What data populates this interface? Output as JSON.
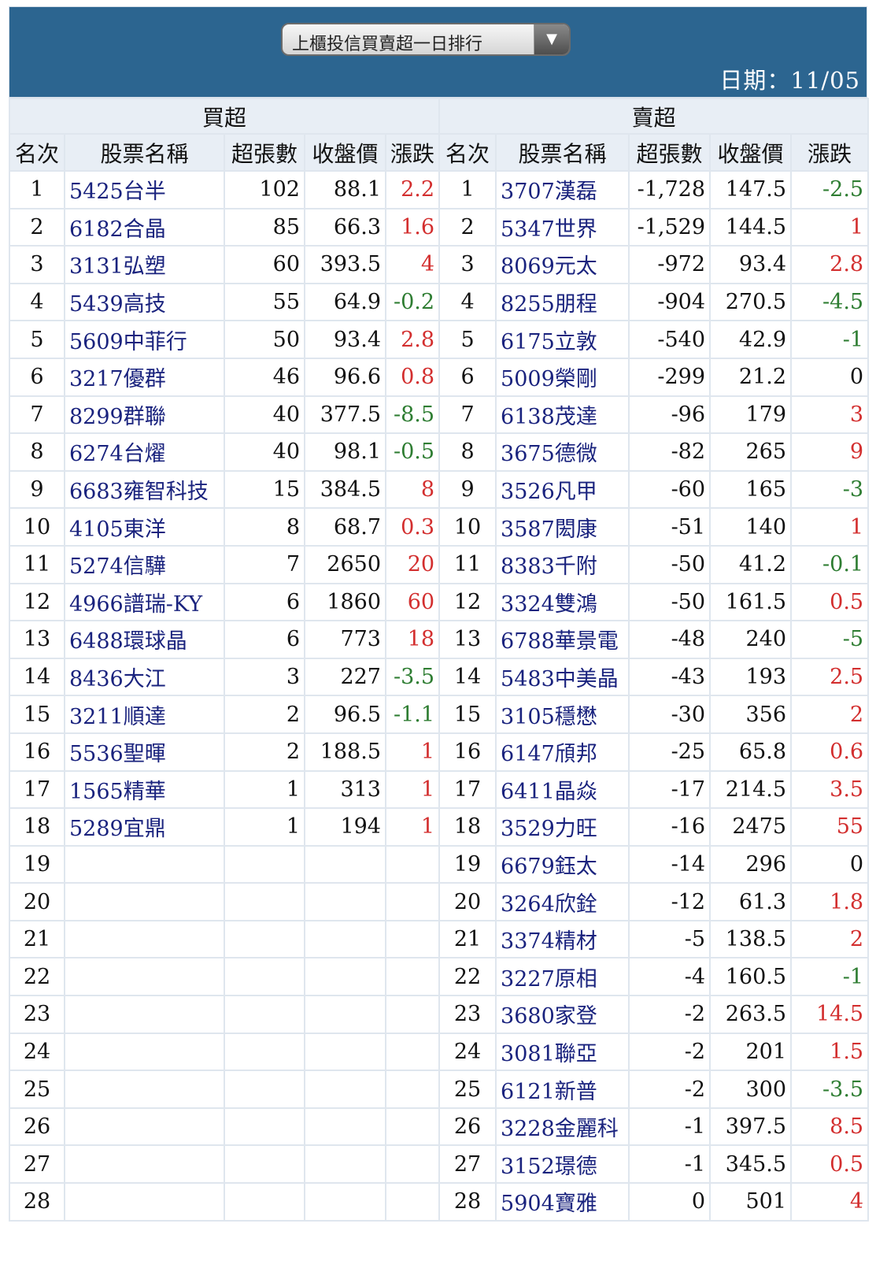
{
  "select": {
    "label": "上櫃投信買賣超一日排行",
    "arrow": "▼"
  },
  "date_text": "日期：11/05",
  "headers": {
    "buy_section": "買超",
    "sell_section": "賣超",
    "rank": "名次",
    "stock": "股票名稱",
    "volume": "超張數",
    "close": "收盤價",
    "change": "漲跌"
  },
  "colors": {
    "header_bg": "#2c6590",
    "up": "#d32f2f",
    "down": "#2e7d32",
    "link": "#1a237e"
  },
  "rows": [
    {
      "rank": "1",
      "buy": {
        "name": "5425台半",
        "vol": "102",
        "price": "88.1",
        "chg": "2.2"
      },
      "sell": {
        "name": "3707漢磊",
        "vol": "-1,728",
        "price": "147.5",
        "chg": "-2.5"
      }
    },
    {
      "rank": "2",
      "buy": {
        "name": "6182合晶",
        "vol": "85",
        "price": "66.3",
        "chg": "1.6"
      },
      "sell": {
        "name": "5347世界",
        "vol": "-1,529",
        "price": "144.5",
        "chg": "1"
      }
    },
    {
      "rank": "3",
      "buy": {
        "name": "3131弘塑",
        "vol": "60",
        "price": "393.5",
        "chg": "4"
      },
      "sell": {
        "name": "8069元太",
        "vol": "-972",
        "price": "93.4",
        "chg": "2.8"
      }
    },
    {
      "rank": "4",
      "buy": {
        "name": "5439高技",
        "vol": "55",
        "price": "64.9",
        "chg": "-0.2"
      },
      "sell": {
        "name": "8255朋程",
        "vol": "-904",
        "price": "270.5",
        "chg": "-4.5"
      }
    },
    {
      "rank": "5",
      "buy": {
        "name": "5609中菲行",
        "vol": "50",
        "price": "93.4",
        "chg": "2.8"
      },
      "sell": {
        "name": "6175立敦",
        "vol": "-540",
        "price": "42.9",
        "chg": "-1"
      }
    },
    {
      "rank": "6",
      "buy": {
        "name": "3217優群",
        "vol": "46",
        "price": "96.6",
        "chg": "0.8"
      },
      "sell": {
        "name": "5009榮剛",
        "vol": "-299",
        "price": "21.2",
        "chg": "0"
      }
    },
    {
      "rank": "7",
      "buy": {
        "name": "8299群聯",
        "vol": "40",
        "price": "377.5",
        "chg": "-8.5"
      },
      "sell": {
        "name": "6138茂達",
        "vol": "-96",
        "price": "179",
        "chg": "3"
      }
    },
    {
      "rank": "8",
      "buy": {
        "name": "6274台燿",
        "vol": "40",
        "price": "98.1",
        "chg": "-0.5"
      },
      "sell": {
        "name": "3675德微",
        "vol": "-82",
        "price": "265",
        "chg": "9"
      }
    },
    {
      "rank": "9",
      "buy": {
        "name": "6683雍智科技",
        "vol": "15",
        "price": "384.5",
        "chg": "8"
      },
      "sell": {
        "name": "3526凡甲",
        "vol": "-60",
        "price": "165",
        "chg": "-3"
      }
    },
    {
      "rank": "10",
      "buy": {
        "name": "4105東洋",
        "vol": "8",
        "price": "68.7",
        "chg": "0.3"
      },
      "sell": {
        "name": "3587閎康",
        "vol": "-51",
        "price": "140",
        "chg": "1"
      }
    },
    {
      "rank": "11",
      "buy": {
        "name": "5274信驊",
        "vol": "7",
        "price": "2650",
        "chg": "20"
      },
      "sell": {
        "name": "8383千附",
        "vol": "-50",
        "price": "41.2",
        "chg": "-0.1"
      }
    },
    {
      "rank": "12",
      "buy": {
        "name": "4966譜瑞-KY",
        "vol": "6",
        "price": "1860",
        "chg": "60"
      },
      "sell": {
        "name": "3324雙鴻",
        "vol": "-50",
        "price": "161.5",
        "chg": "0.5"
      }
    },
    {
      "rank": "13",
      "buy": {
        "name": "6488環球晶",
        "vol": "6",
        "price": "773",
        "chg": "18"
      },
      "sell": {
        "name": "6788華景電",
        "vol": "-48",
        "price": "240",
        "chg": "-5"
      }
    },
    {
      "rank": "14",
      "buy": {
        "name": "8436大江",
        "vol": "3",
        "price": "227",
        "chg": "-3.5"
      },
      "sell": {
        "name": "5483中美晶",
        "vol": "-43",
        "price": "193",
        "chg": "2.5"
      }
    },
    {
      "rank": "15",
      "buy": {
        "name": "3211順達",
        "vol": "2",
        "price": "96.5",
        "chg": "-1.1"
      },
      "sell": {
        "name": "3105穩懋",
        "vol": "-30",
        "price": "356",
        "chg": "2"
      }
    },
    {
      "rank": "16",
      "buy": {
        "name": "5536聖暉",
        "vol": "2",
        "price": "188.5",
        "chg": "1"
      },
      "sell": {
        "name": "6147頎邦",
        "vol": "-25",
        "price": "65.8",
        "chg": "0.6"
      }
    },
    {
      "rank": "17",
      "buy": {
        "name": "1565精華",
        "vol": "1",
        "price": "313",
        "chg": "1"
      },
      "sell": {
        "name": "6411晶焱",
        "vol": "-17",
        "price": "214.5",
        "chg": "3.5"
      }
    },
    {
      "rank": "18",
      "buy": {
        "name": "5289宜鼎",
        "vol": "1",
        "price": "194",
        "chg": "1"
      },
      "sell": {
        "name": "3529力旺",
        "vol": "-16",
        "price": "2475",
        "chg": "55"
      }
    },
    {
      "rank": "19",
      "buy": null,
      "sell": {
        "name": "6679鈺太",
        "vol": "-14",
        "price": "296",
        "chg": "0"
      }
    },
    {
      "rank": "20",
      "buy": null,
      "sell": {
        "name": "3264欣銓",
        "vol": "-12",
        "price": "61.3",
        "chg": "1.8"
      }
    },
    {
      "rank": "21",
      "buy": null,
      "sell": {
        "name": "3374精材",
        "vol": "-5",
        "price": "138.5",
        "chg": "2"
      }
    },
    {
      "rank": "22",
      "buy": null,
      "sell": {
        "name": "3227原相",
        "vol": "-4",
        "price": "160.5",
        "chg": "-1"
      }
    },
    {
      "rank": "23",
      "buy": null,
      "sell": {
        "name": "3680家登",
        "vol": "-2",
        "price": "263.5",
        "chg": "14.5"
      }
    },
    {
      "rank": "24",
      "buy": null,
      "sell": {
        "name": "3081聯亞",
        "vol": "-2",
        "price": "201",
        "chg": "1.5"
      }
    },
    {
      "rank": "25",
      "buy": null,
      "sell": {
        "name": "6121新普",
        "vol": "-2",
        "price": "300",
        "chg": "-3.5"
      }
    },
    {
      "rank": "26",
      "buy": null,
      "sell": {
        "name": "3228金麗科",
        "vol": "-1",
        "price": "397.5",
        "chg": "8.5"
      }
    },
    {
      "rank": "27",
      "buy": null,
      "sell": {
        "name": "3152璟德",
        "vol": "-1",
        "price": "345.5",
        "chg": "0.5"
      }
    },
    {
      "rank": "28",
      "buy": null,
      "sell": {
        "name": "5904寶雅",
        "vol": "0",
        "price": "501",
        "chg": "4"
      }
    }
  ]
}
